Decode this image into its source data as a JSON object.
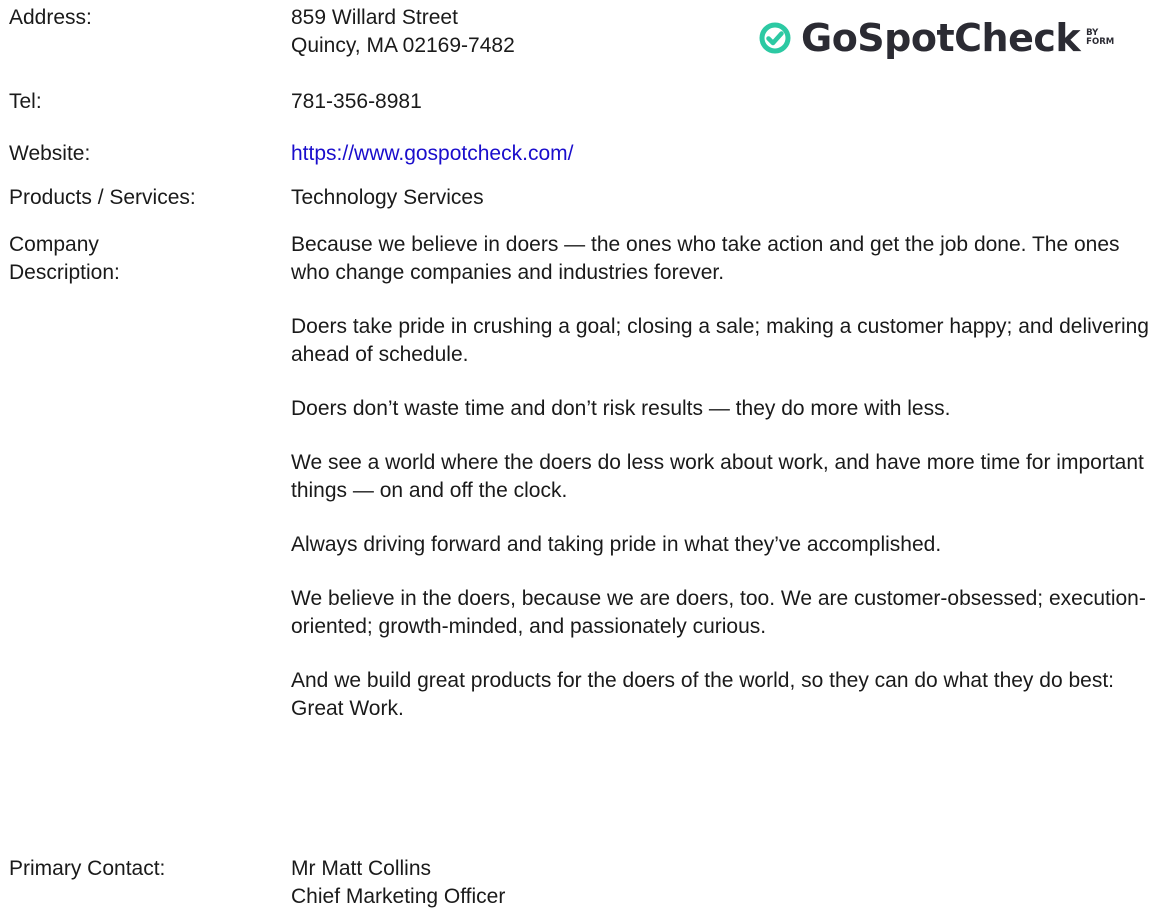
{
  "logo": {
    "name": "GoSpotCheck",
    "by_line1": "BY",
    "by_line2": "FORM",
    "brand_color": "#2CC9A3",
    "icon": "check-circle-icon"
  },
  "fields": {
    "address": {
      "label": "Address:",
      "line1": "859 Willard Street",
      "line2": "Quincy, MA 02169-7482"
    },
    "tel": {
      "label": "Tel:",
      "value": "781-356-8981"
    },
    "website": {
      "label": "Website:",
      "value": "https://www.gospotcheck.com/"
    },
    "products": {
      "label": "Products / Services:",
      "value": "Technology Services"
    },
    "description": {
      "label_line1": "Company",
      "label_line2": "Description:",
      "paragraphs": [
        "Because we believe in doers — the ones who take action and get the job done. The ones who change companies and industries forever.",
        "Doers take pride in crushing a goal; closing a sale; making a customer happy; and delivering ahead of schedule.",
        "Doers don’t waste time and don’t risk results — they do more with less.",
        "We see a world where the doers do less work about work, and have more time for important things — on and off the clock.",
        "Always driving forward and taking pride in what they’ve accomplished.",
        "We believe in the doers, because we are doers, too. We are customer-obsessed; execution-oriented; growth-minded, and passionately curious.",
        "And we build great products for the doers of the world, so they can do what they do best: Great Work."
      ]
    },
    "contact": {
      "label": "Primary Contact:",
      "name": "Mr Matt Collins",
      "title": "Chief Marketing Officer"
    }
  }
}
